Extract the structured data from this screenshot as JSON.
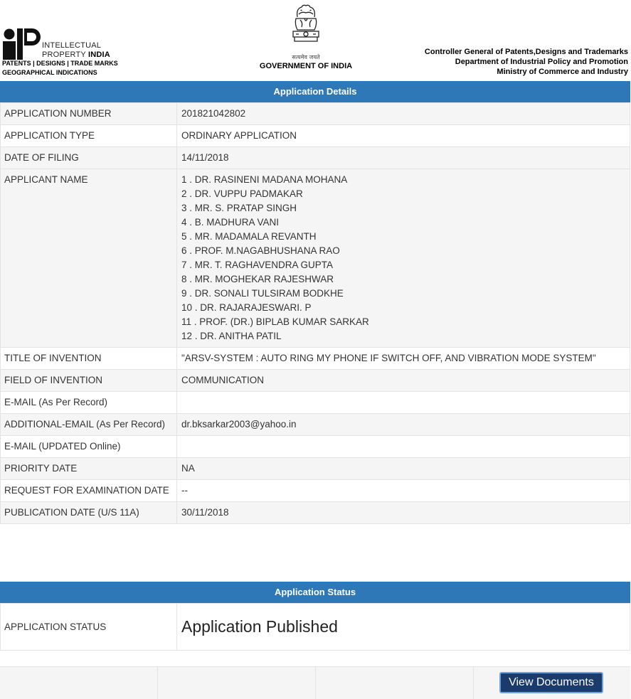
{
  "header": {
    "ipi_line1": "INTELLECTUAL",
    "ipi_line2a": "PROPERTY ",
    "ipi_line2b": "INDIA",
    "ipi_line3": "PATENTS | DESIGNS | TRADE MARKS",
    "ipi_line4": "GEOGRAPHICAL INDICATIONS",
    "motto": "सत्यमेव जयते",
    "gov": "GOVERNMENT OF INDIA",
    "ministry_line1": "Controller General of Patents,Designs and Trademarks",
    "ministry_line2": "Department of Industrial Policy and Promotion",
    "ministry_line3": "Ministry of Commerce and Industry"
  },
  "details": {
    "title": "Application Details",
    "application_number": {
      "label": "APPLICATION NUMBER",
      "value": "201821042802"
    },
    "application_type": {
      "label": "APPLICATION TYPE",
      "value": "ORDINARY APPLICATION"
    },
    "date_of_filing": {
      "label": "DATE OF FILING",
      "value": "14/11/2018"
    },
    "applicant_label": "APPLICANT NAME",
    "applicants": [
      "1 . DR. RASINENI MADANA MOHANA",
      "2 . DR. VUPPU PADMAKAR",
      "3 . MR. S. PRATAP SINGH",
      "4 . B. MADHURA VANI",
      "5 . MR. MADAMALA REVANTH",
      "6 . PROF. M.NAGABHUSHANA RAO",
      "7 . MR. T. RAGHAVENDRA GUPTA",
      "8 . MR. MOGHEKAR RAJESHWAR",
      "9 . DR. SONALI TULSIRAM BODKHE",
      "10 . DR. RAJARAJESWARI. P",
      "11 . PROF. (DR.) BIPLAB KUMAR SARKAR",
      "12 . DR. ANITHA PATIL"
    ],
    "title_of_invention": {
      "label": "TITLE OF INVENTION",
      "value": "\"ARSV-SYSTEM : AUTO RING MY PHONE IF SWITCH OFF, AND VIBRATION MODE SYSTEM\""
    },
    "field_of_invention": {
      "label": "FIELD OF INVENTION",
      "value": "COMMUNICATION"
    },
    "email": {
      "label": "E-MAIL (As Per Record)",
      "value": ""
    },
    "additional_email": {
      "label": "ADDITIONAL-EMAIL (As Per Record)",
      "value": "dr.bksarkar2003@yahoo.in"
    },
    "email_updated": {
      "label": "E-MAIL (UPDATED Online)",
      "value": ""
    },
    "priority_date": {
      "label": "PRIORITY DATE",
      "value": "NA"
    },
    "request_exam_date": {
      "label": "REQUEST FOR EXAMINATION DATE",
      "value": "--"
    },
    "publication_date": {
      "label": "PUBLICATION DATE (U/S 11A)",
      "value": "30/11/2018"
    }
  },
  "status": {
    "title": "Application Status",
    "label": "APPLICATION STATUS",
    "value": "Application Published"
  },
  "footer": {
    "view_documents": "View Documents"
  },
  "colors": {
    "bar": "#2f78b8",
    "button": "#1a3b6b"
  }
}
